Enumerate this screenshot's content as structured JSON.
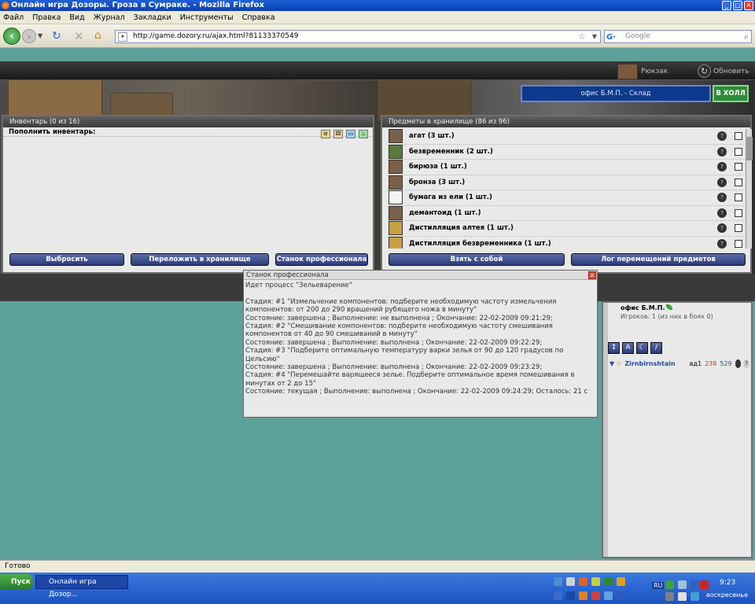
{
  "window": {
    "title": "Онлайн игра Дозоры. Гроза в Сумраке. - Mozilla Firefox"
  },
  "menu": [
    "Файл",
    "Правка",
    "Вид",
    "Журнал",
    "Закладки",
    "Инструменты",
    "Справка"
  ],
  "nav": {
    "url": "http://game.dozory.ru/ajax.html?81133370549",
    "search_placeholder": "Google"
  },
  "game": {
    "rucksack_label": "Рюкзак",
    "refresh_label": "Обновить",
    "location": "офис Б.М.П. - Склад",
    "hall_button": "В ХОЛЛ"
  },
  "inventory": {
    "title": "Инвентарь (0 из 16)",
    "refill_label": "Пополнить инвентарь:",
    "buttons": [
      "Выбросить",
      "Переложить в хранилище",
      "Станок профессионала"
    ]
  },
  "storage": {
    "title": "Предметы в хранилище (86 из 96)",
    "items": [
      "агат (3 шт.)",
      "безвременник (2 шт.)",
      "бирюза (1 шт.)",
      "бронза (3 шт.)",
      "бумага из ели (1 шт.)",
      "демантоид (1 шт.)",
      "Дистилляция алтея (1 шт.)",
      "Дистилляция безвременника (1 шт.)"
    ],
    "buttons": [
      "Взять с собой",
      "Лог перемещений предметов"
    ]
  },
  "dialog": {
    "title": "Станок профессионала",
    "lines": [
      "Идет процесс \"Зельеварение\"",
      "",
      "Стадия: #1 \"Измельчение компонентов: подберите необходимую частоту измельчения компонентов: от 200 до 290 вращений рубящего ножа в минуту\"",
      "Состояние:  завершена ; Выполнение:  не выполнена ;  Окончание: 22-02-2009 09:21:29;",
      "Стадия: #2 \"Смешивание компонентов: подберите необходимую частоту смешивания компонентов от 40 до 90 смешиваний в минуту\"",
      "Состояние:  завершена ; Выполнение:  выполнена ;  Окончание: 22-02-2009 09:22:29;",
      "Стадия: #3 \"Подберите оптимальную температуру варки зелья от 90 до 120 градусов по Цельсию\"",
      "Состояние:  завершена ; Выполнение:  выполнена ;  Окончание: 22-02-2009 09:23:29;",
      "Стадия: #4 \"Перемешайте варящееся зелье. Подберите оптимальное время помешивания в минутах от 2 до 15\"",
      "Состояние:  текущая ; Выполнение:  выполнена ;  Окончание: 22-02-2009 09:24:29;  Осталось:  21 с"
    ]
  },
  "players": {
    "place": "офис Б.М.П.",
    "count": "Игроков: 1 (из них в боях 0)",
    "player": {
      "nick": "Zirnbirnshtain",
      "level": "вд1",
      "num1": "238",
      "num2": "529"
    }
  },
  "status": "Готово",
  "taskbar": {
    "start": "Пуск",
    "task": "Онлайн игра Дозор...",
    "lang": "RU",
    "time": "9:23",
    "day": "воскресенье"
  }
}
